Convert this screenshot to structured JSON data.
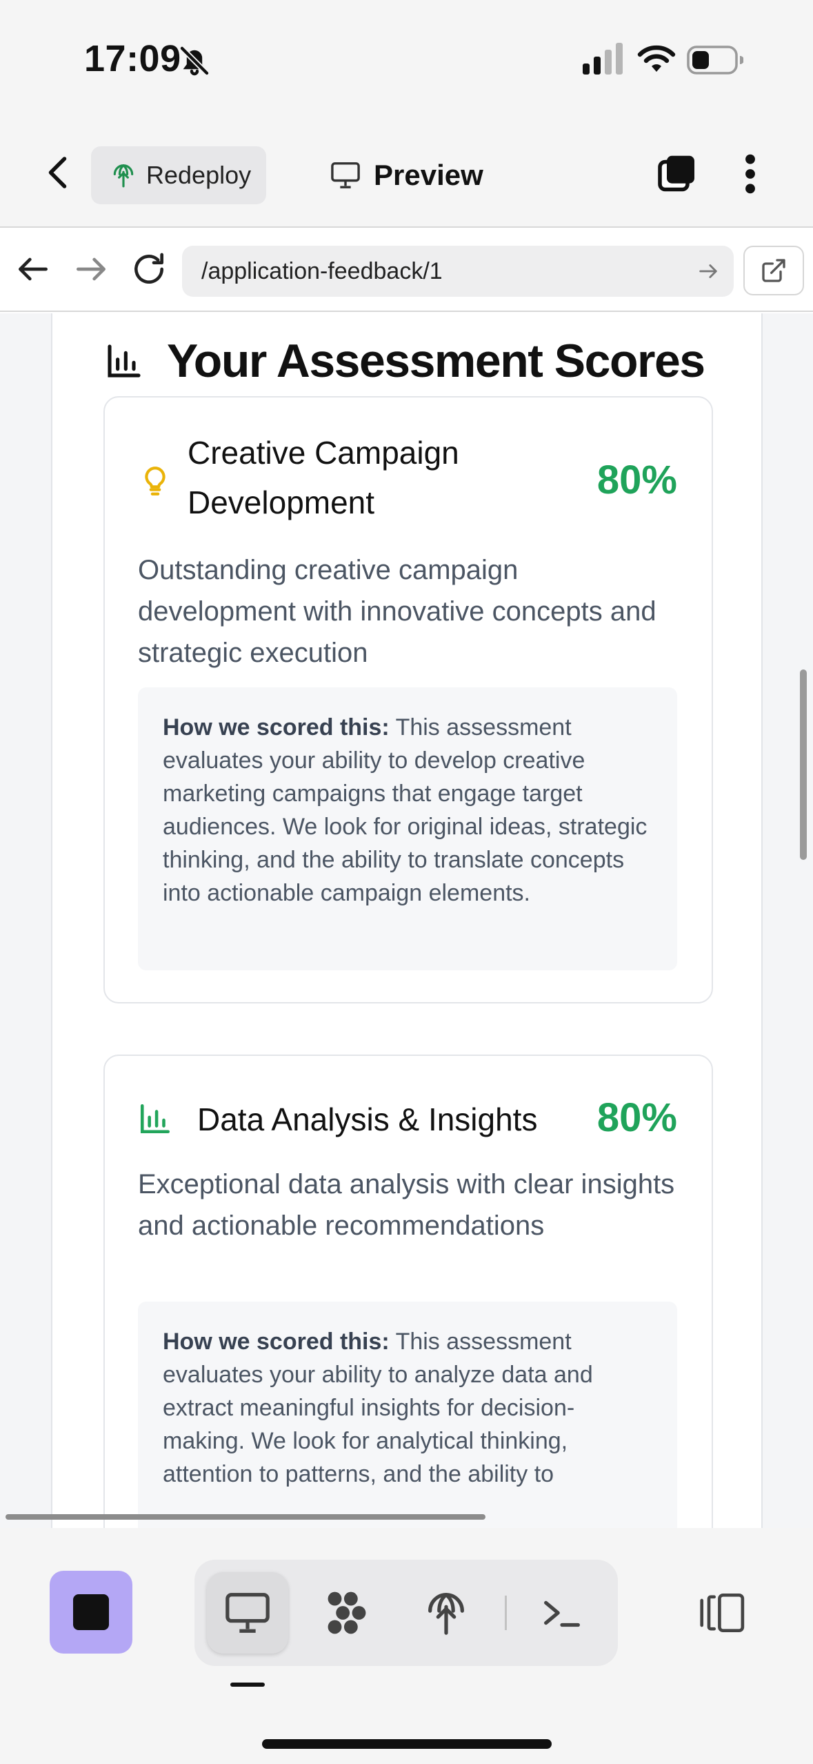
{
  "status_bar": {
    "time": "17:09"
  },
  "header": {
    "redeploy_label": "Redeploy",
    "preview_label": "Preview"
  },
  "browser": {
    "url": "/application-feedback/1"
  },
  "section": {
    "title": "Your Assessment Scores"
  },
  "cards": [
    {
      "title": "Creative Campaign Development",
      "title_line1": "Creative Campaign",
      "title_line2": "Development",
      "percent": "80%",
      "description": "Outstanding creative campaign development with innovative concepts and strategic execution",
      "scoring_label": "How we scored this:",
      "scoring_text": "This assessment evaluates your ability to develop creative marketing campaigns that engage target audiences. We look for original ideas, strategic thinking, and the ability to translate concepts into actionable campaign elements.",
      "icon": "lightbulb-icon",
      "icon_color": "#eab308"
    },
    {
      "title": "Data Analysis & Insights",
      "percent": "80%",
      "description": "Exceptional data analysis with clear insights and actionable recommendations",
      "scoring_label": "How we scored this:",
      "scoring_text": "This assessment evaluates your ability to analyze data and extract meaningful insights for decision-making. We look for analytical thinking, attention to patterns, and the ability to",
      "icon": "bar-chart-icon",
      "icon_color": "#22a55b"
    }
  ],
  "colors": {
    "score_green": "#1fa35a",
    "stop_button": "#b4a7f5"
  },
  "toolbar": {
    "active_tool": "preview"
  }
}
